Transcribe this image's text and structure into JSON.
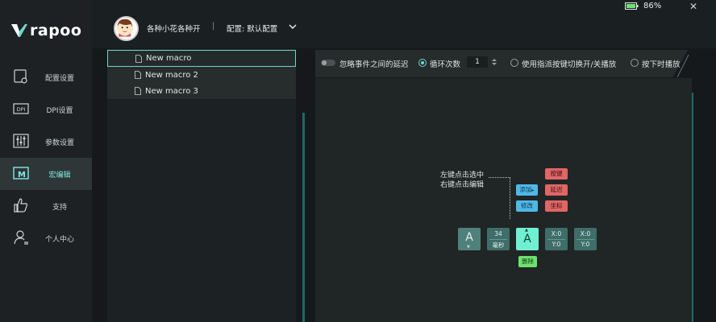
{
  "brand": {
    "name": "rapoo",
    "logo_mark": "V"
  },
  "colors": {
    "accent": "#6fd6cc",
    "teal_line": "#1d6a63",
    "add_blue": "#4fb8e8",
    "red": "#e06666",
    "green": "#6ee26e"
  },
  "header": {
    "profile_name": "各种小花各种开",
    "separator": "|",
    "config_label": "配置: 默认配置",
    "battery_percent": "86%",
    "minimize": "—",
    "close": "✕"
  },
  "sidebar": {
    "items": [
      {
        "icon": "config-settings-icon",
        "label": "配置设置",
        "active": false
      },
      {
        "icon": "dpi-icon",
        "label": "DPI设置",
        "active": false
      },
      {
        "icon": "sliders-icon",
        "label": "参数设置",
        "active": false
      },
      {
        "icon": "macro-icon",
        "label": "宏编辑",
        "active": true
      },
      {
        "icon": "thumbs-up-icon",
        "label": "支持",
        "active": false
      },
      {
        "icon": "user-icon",
        "label": "个人中心",
        "active": false
      }
    ]
  },
  "macros": {
    "items": [
      {
        "label": "New macro",
        "selected": true
      },
      {
        "label": "New macro 2",
        "selected": false
      },
      {
        "label": "New macro 3",
        "selected": false
      }
    ]
  },
  "options": {
    "ignore_delay_label": "忽略事件之间的延迟",
    "loop_label": "循环次数",
    "loop_count": "1",
    "toggle_label": "使用指派按键切换开/关播放",
    "hold_label": "按下时播放"
  },
  "editor": {
    "hint_line1": "左键点击选中",
    "hint_line2": "右键点击编辑",
    "add_label": "添加",
    "edit_label": "修改",
    "key_label": "按键",
    "delay_label": "延迟",
    "coord_label": "坐标",
    "delete_label": "删除",
    "key_a": "A",
    "key_a_active": "A",
    "delay_value": "34",
    "delay_unit": "毫秒",
    "coord1_x": "X:0",
    "coord1_y": "Y:0",
    "coord2_x": "X:0",
    "coord2_y": "Y:0"
  }
}
